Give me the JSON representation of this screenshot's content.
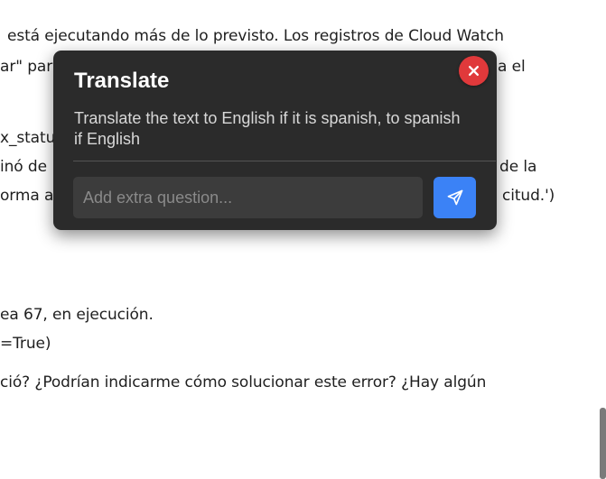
{
  "background": {
    "lines": [
      "está ejecutando más de lo previsto. Los registros de Cloud Watch",
      "ar\" par",
      "a el",
      "x_statu",
      "inó de",
      "de la",
      "orma a",
      "citud.')",
      "ea 67, en ejecución.",
      "=True)",
      "ció? ¿Podrían indicarme cómo solucionar este error? ¿Hay algún"
    ]
  },
  "popup": {
    "title": "Translate",
    "description": "Translate the text to English if it is spanish, to spanish if English",
    "input_placeholder": "Add extra question...",
    "input_value": "",
    "send_icon": "send-icon",
    "close_icon": "close-icon"
  },
  "colors": {
    "popup_bg": "#2b2b2b",
    "send_button": "#3b82f6",
    "close_button": "#e0393b"
  }
}
